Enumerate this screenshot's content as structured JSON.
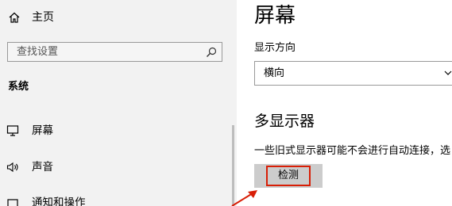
{
  "sidebar": {
    "home_label": "主页",
    "search_placeholder": "查找设置",
    "group_title": "系统",
    "items": [
      {
        "label": "屏幕",
        "icon": "monitor-icon"
      },
      {
        "label": "声音",
        "icon": "speaker-icon"
      },
      {
        "label": "通知和操作",
        "icon": "notification-icon"
      }
    ]
  },
  "main": {
    "title": "屏幕",
    "orientation": {
      "label": "显示方向",
      "value": "横向"
    },
    "multi_display": {
      "title": "多显示器",
      "description": "一些旧式显示器可能不会进行自动连接，选",
      "detect_label": "检测"
    }
  },
  "colors": {
    "sidebar_bg": "#f2f2f2",
    "button_bg": "#cccccc",
    "highlight": "#d81e06"
  }
}
